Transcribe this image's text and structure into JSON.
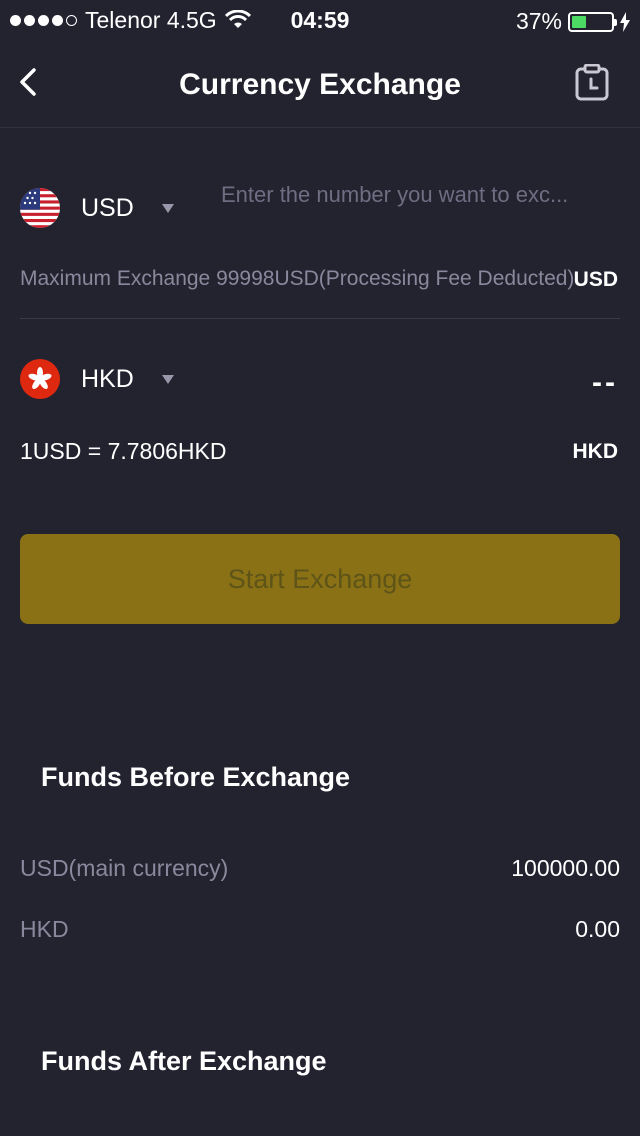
{
  "status_bar": {
    "carrier": "Telenor 4.5G",
    "time": "04:59",
    "battery_percent": "37%",
    "battery_level": 0.37
  },
  "nav": {
    "title": "Currency Exchange",
    "back_icon": "chevron-left-icon",
    "history_icon": "clipboard-clock-icon"
  },
  "from": {
    "currency": "USD",
    "flag_icon": "us-flag-icon",
    "amount_value": "",
    "amount_placeholder": "Enter the number you want to exc...",
    "max_text": "Maximum Exchange 99998USD(Processing Fee Deducted)",
    "unit": "USD"
  },
  "to": {
    "currency": "HKD",
    "flag_icon": "hk-flag-icon",
    "amount": "--",
    "rate_text": "1USD = 7.7806HKD",
    "unit": "HKD"
  },
  "action": {
    "start_label": "Start Exchange",
    "color": "#8a7115"
  },
  "funds_before": {
    "title": "Funds Before Exchange",
    "rows": [
      {
        "label": "USD(main currency)",
        "value": "100000.00"
      },
      {
        "label": "HKD",
        "value": "0.00"
      }
    ]
  },
  "funds_after": {
    "title": "Funds After Exchange"
  },
  "colors": {
    "background": "#23222f",
    "accent": "#8a7115",
    "muted_text": "#8a889c"
  }
}
